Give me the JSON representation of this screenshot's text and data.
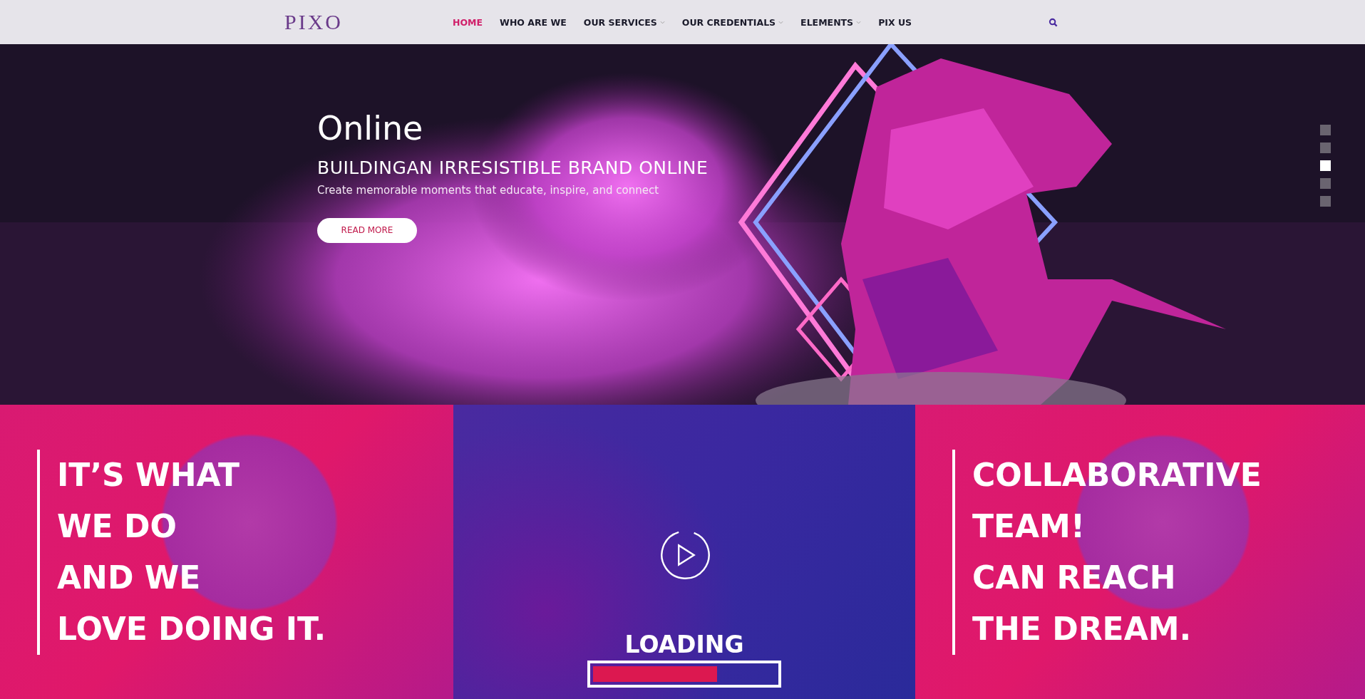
{
  "header": {
    "logo": "PIXO",
    "nav": [
      {
        "label": "HOME",
        "selected": true,
        "dropdown": false
      },
      {
        "label": "WHO ARE WE",
        "selected": false,
        "dropdown": false
      },
      {
        "label": "OUR SERVICES",
        "selected": false,
        "dropdown": true
      },
      {
        "label": "OUR CREDENTIALS",
        "selected": false,
        "dropdown": true
      },
      {
        "label": "ELEMENTS",
        "selected": false,
        "dropdown": true
      },
      {
        "label": "PIX US",
        "selected": false,
        "dropdown": false
      }
    ]
  },
  "hero": {
    "kind": "picture",
    "title": "Online",
    "headline": "BUILDINGAN IRRESISTIBLE BRAND ONLINE",
    "subtitle": "Create memorable moments that educate, inspire, and connect",
    "button": "READ MORE",
    "slides": [
      {
        "selected": false
      },
      {
        "selected": false
      },
      {
        "selected": true
      },
      {
        "selected": false
      },
      {
        "selected": false
      }
    ]
  },
  "panels": [
    {
      "kind": "text",
      "lines": [
        "IT’S WHAT",
        "WE DO",
        "AND WE",
        "LOVE DOING IT."
      ]
    },
    {
      "kind": "video",
      "label": "LOADING",
      "level": 0.69
    },
    {
      "kind": "text",
      "lines": [
        "COLLABORATIVE",
        "TEAM!",
        "CAN REACH",
        "THE DREAM."
      ]
    }
  ]
}
